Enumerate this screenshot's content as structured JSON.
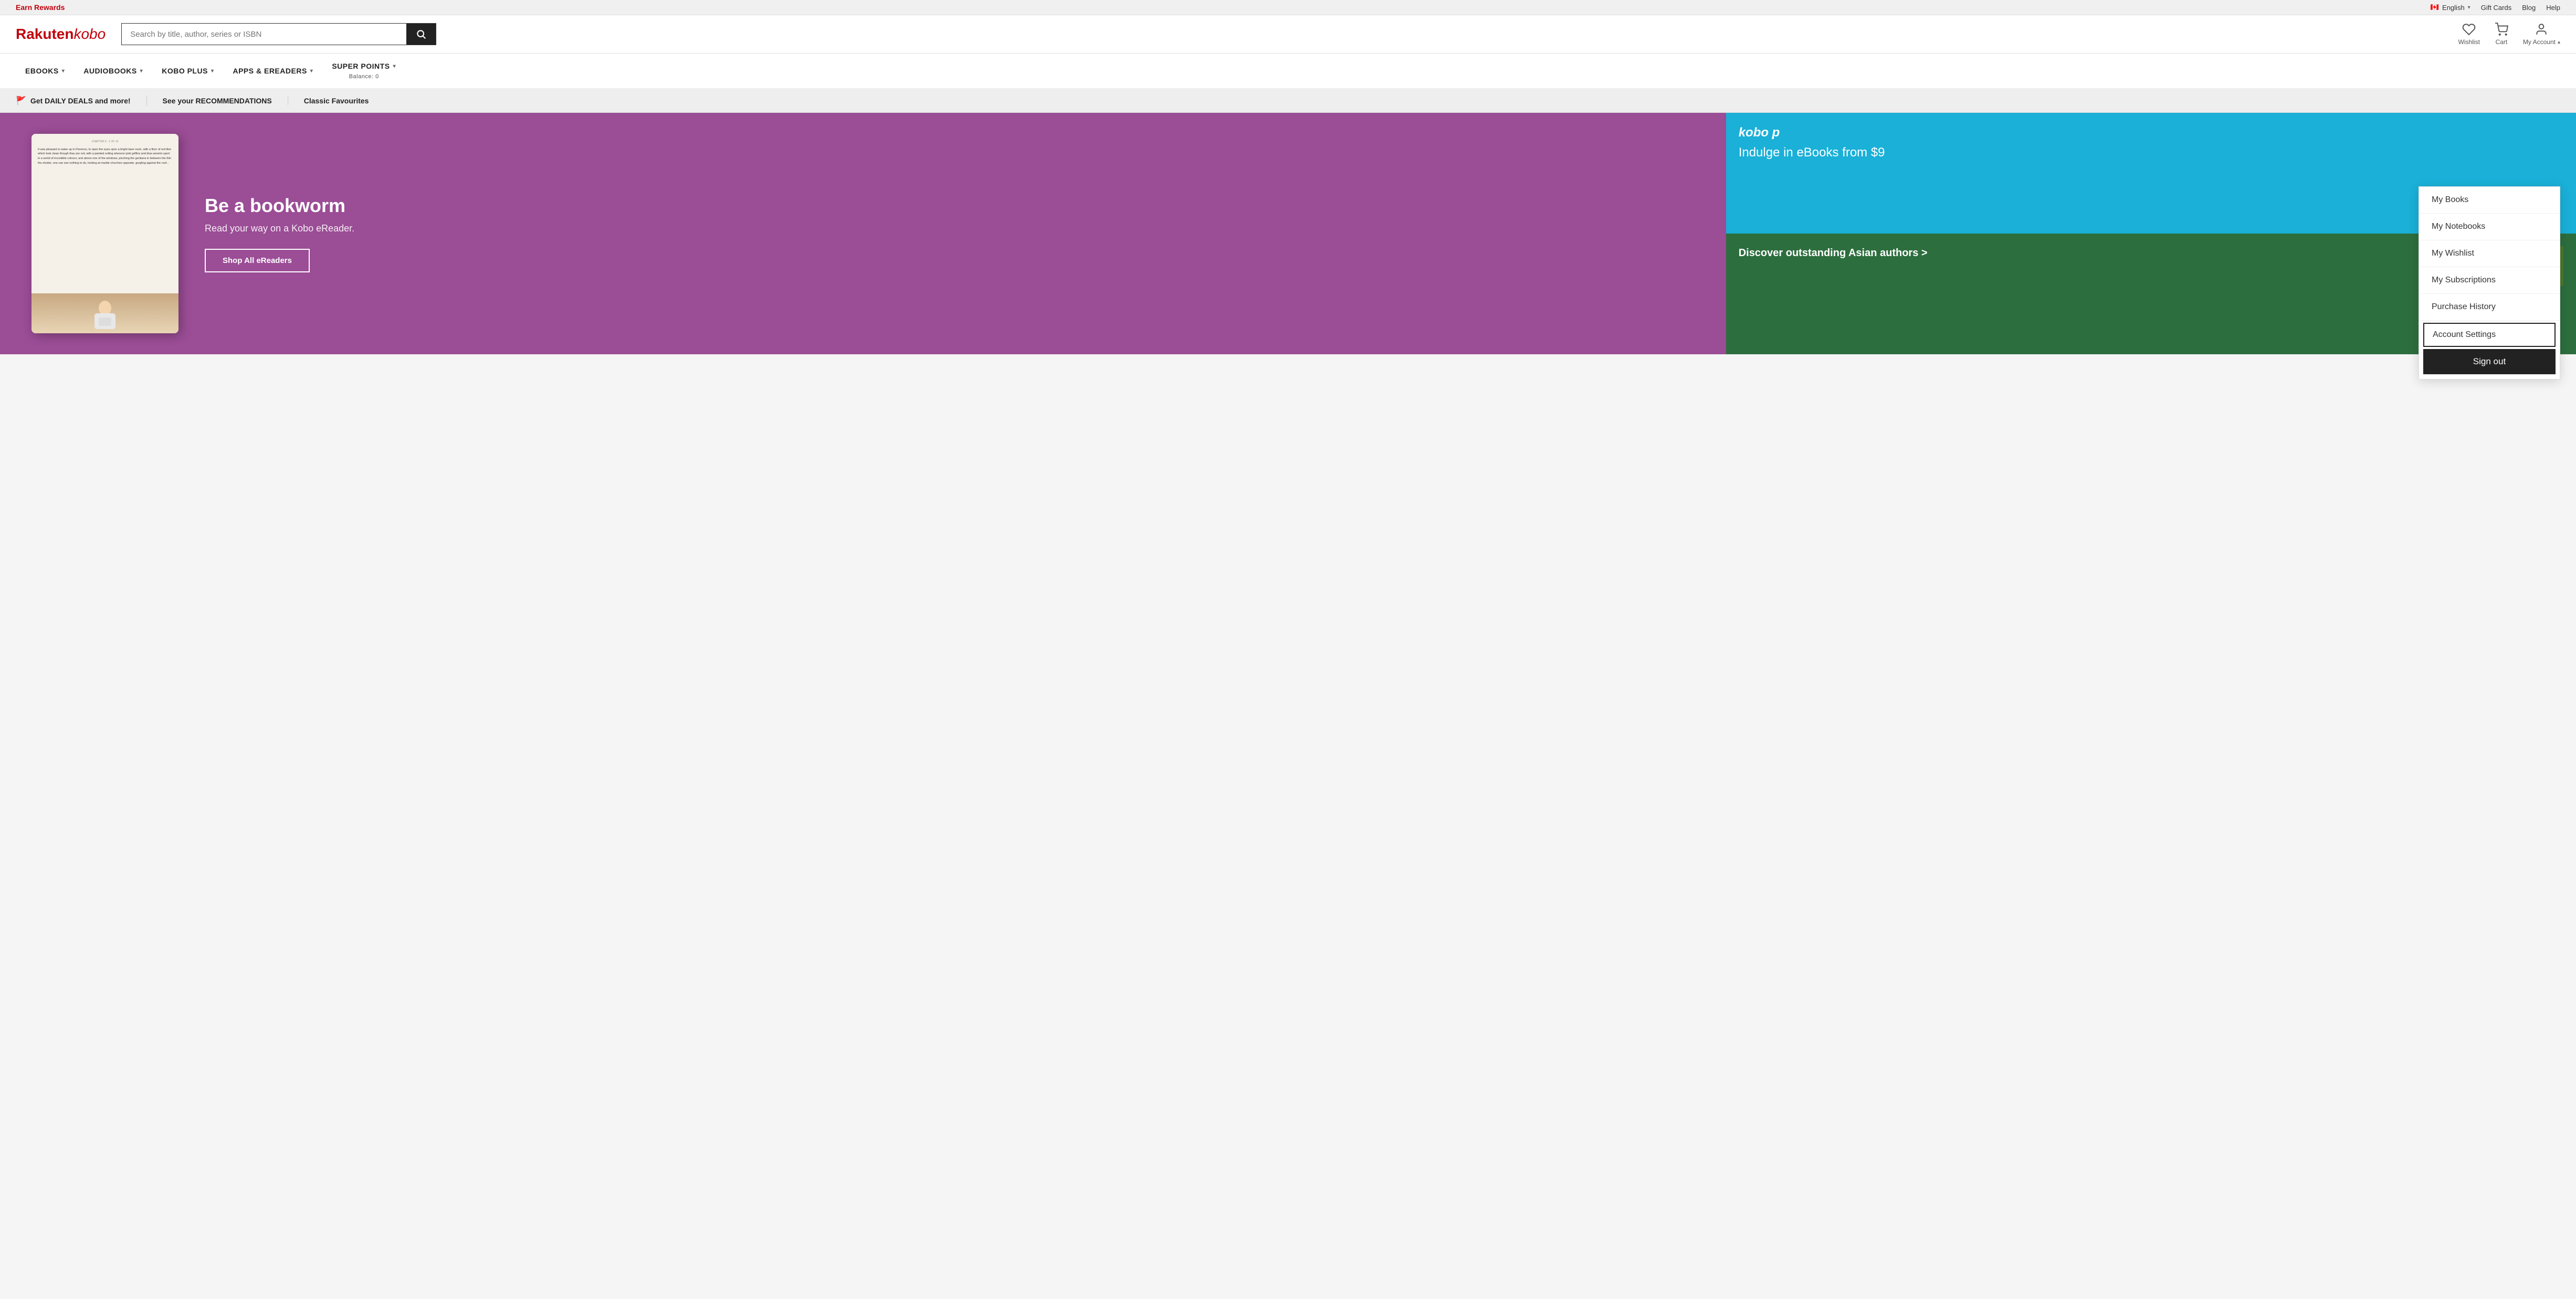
{
  "topbar": {
    "earn_rewards": "Earn Rewards",
    "language": "English",
    "gift_cards": "Gift Cards",
    "blog": "Blog",
    "help": "Help"
  },
  "header": {
    "logo_rakuten": "Rakuten",
    "logo_kobo": "kobo",
    "search_placeholder": "Search by title, author, series or ISBN",
    "wishlist_label": "Wishlist",
    "cart_label": "Cart",
    "my_account_label": "My Account"
  },
  "nav": {
    "items": [
      {
        "label": "eBOOKS",
        "has_chevron": true
      },
      {
        "label": "AUDIOBOOKS",
        "has_chevron": true
      },
      {
        "label": "KOBO PLUS",
        "has_chevron": true
      },
      {
        "label": "APPS & eREADERS",
        "has_chevron": true
      },
      {
        "label": "SUPER POINTS",
        "has_chevron": true,
        "balance": "Balance: 0"
      }
    ]
  },
  "promo_bar": {
    "items": [
      {
        "label": "Get DAILY DEALS and more!",
        "has_flag": true
      },
      {
        "label": "See your RECOMMENDATIONS"
      },
      {
        "label": "Classic Favourites"
      }
    ]
  },
  "hero": {
    "title": "Be a bookworm",
    "subtitle": "Read your way on a Kobo eReader.",
    "cta": "Shop All eReaders",
    "device_text": "It was pleasant to wake up in Florence, to open the eyes upon a bright bare room, with a floor of red tiles which look clean though they are not; with a painted ceiling whereon pink griffins and blue amorini sport in a world of incredible colours; and above one of the windows, pinching the gentians in between the thin the shutter, one can see nothing to do, looking at marble churches opposite, gurgling against the roof..."
  },
  "side_panel_top": {
    "logo": "kobo p",
    "text": "Indulge in eBooks from $9"
  },
  "side_panel_bottom": {
    "text": "Discover outstanding Asian authors >"
  },
  "dropdown": {
    "my_books": "My Books",
    "my_notebooks": "My Notebooks",
    "my_wishlist": "My Wishlist",
    "my_subscriptions": "My Subscriptions",
    "purchase_history": "Purchase History",
    "account_settings": "Account Settings",
    "sign_out": "Sign out"
  },
  "book_covers": [
    {
      "color": "#e8b04a",
      "label": "book1"
    },
    {
      "color": "#d4452a",
      "label": "book2"
    },
    {
      "color": "#2a6b8c",
      "label": "book3"
    },
    {
      "color": "#3a3a5c",
      "label": "book4"
    },
    {
      "color": "#5c8a3a",
      "label": "book5"
    }
  ],
  "icons": {
    "search": "🔍",
    "wishlist": "♡",
    "cart": "🛒",
    "account": "👤",
    "flag": "🇨🇦"
  }
}
